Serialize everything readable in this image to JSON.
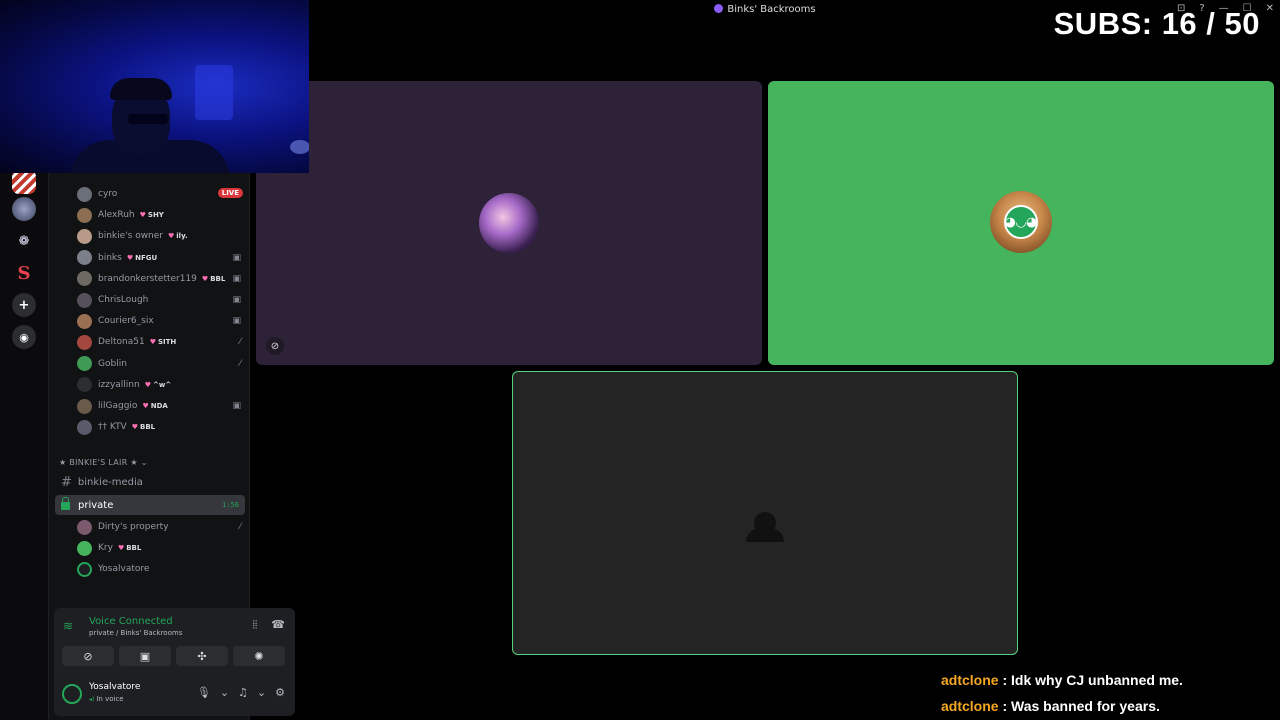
{
  "window": {
    "title": "Binks' Backrooms",
    "controls": [
      "⊡",
      "?",
      "—",
      "☐",
      "✕"
    ]
  },
  "overlay": {
    "subs_label": "SUBS: 16 / 50"
  },
  "rail": {
    "servers": [
      {
        "name": "server-red-stripes",
        "glyph": "",
        "color": "#c0392b"
      },
      {
        "name": "server-avatar",
        "glyph": "",
        "color": "#4a4f6a"
      },
      {
        "name": "server-butterfly",
        "glyph": "❁",
        "color": "#0b0b0d"
      },
      {
        "name": "server-s",
        "glyph": "S",
        "color": "#7a1020"
      },
      {
        "name": "add-server",
        "glyph": "+",
        "color": "#2b2d31"
      },
      {
        "name": "explore-servers",
        "glyph": "⊘",
        "color": "#2b2d31"
      }
    ]
  },
  "members_top": [
    {
      "name": "cyro",
      "tag": "",
      "right": "LIVE",
      "color": "#6b6f7a"
    },
    {
      "name": "AlexRuh",
      "tag": "SHY",
      "right": "",
      "color": "#8c6f52"
    },
    {
      "name": "binkie's owner",
      "tag": "ily.",
      "right": "",
      "color": "#b89a88"
    },
    {
      "name": "binks",
      "tag": "NFGU",
      "right": "▣",
      "color": "#7a7f8a"
    },
    {
      "name": "brandonkerstetter119",
      "tag": "BBL",
      "right": "▣",
      "color": "#6e6a63"
    },
    {
      "name": "ChrisLough",
      "tag": "",
      "right": "▣",
      "color": "#55505a"
    },
    {
      "name": "Courier6_six",
      "tag": "",
      "right": "▣",
      "color": "#9a7052"
    },
    {
      "name": "Deltona51",
      "tag": "SITH",
      "right": "⁄",
      "color": "#a4473e"
    },
    {
      "name": "Goblin",
      "tag": "",
      "right": "⁄",
      "color": "#3f9a55"
    },
    {
      "name": "izzyallinn",
      "tag": "^w^",
      "right": "",
      "color": "#2b2d31"
    },
    {
      "name": "lilGaggio",
      "tag": "NDA",
      "right": "▣",
      "color": "#6a5a4a"
    },
    {
      "name": "†† KTV",
      "tag": "BBL",
      "right": "",
      "color": "#5a5a6a"
    }
  ],
  "category": {
    "label": "★ BINKIE'S LAIR ★ ⌄"
  },
  "channels": {
    "media": "binkie-media",
    "private": "private",
    "private_timer": "1:56"
  },
  "members_private": [
    {
      "name": "Dirty's property",
      "tag": "",
      "right": "⁄",
      "color": "#7b5a6e"
    },
    {
      "name": "Kry",
      "tag": "BBL",
      "right": "",
      "color": "#46b35d"
    },
    {
      "name": "Yosalvatore",
      "tag": "",
      "right": "",
      "color": "#1e1f22"
    }
  ],
  "voice": {
    "title": "Voice Connected",
    "sub": "private / Binks' Backrooms"
  },
  "user": {
    "name": "Yosalvatore",
    "status": "In voice"
  },
  "chat": [
    {
      "user": "adtclone",
      "text": " : Idk why CJ unbanned me."
    },
    {
      "user": "adtclone",
      "text": " : Was banned for years."
    }
  ]
}
